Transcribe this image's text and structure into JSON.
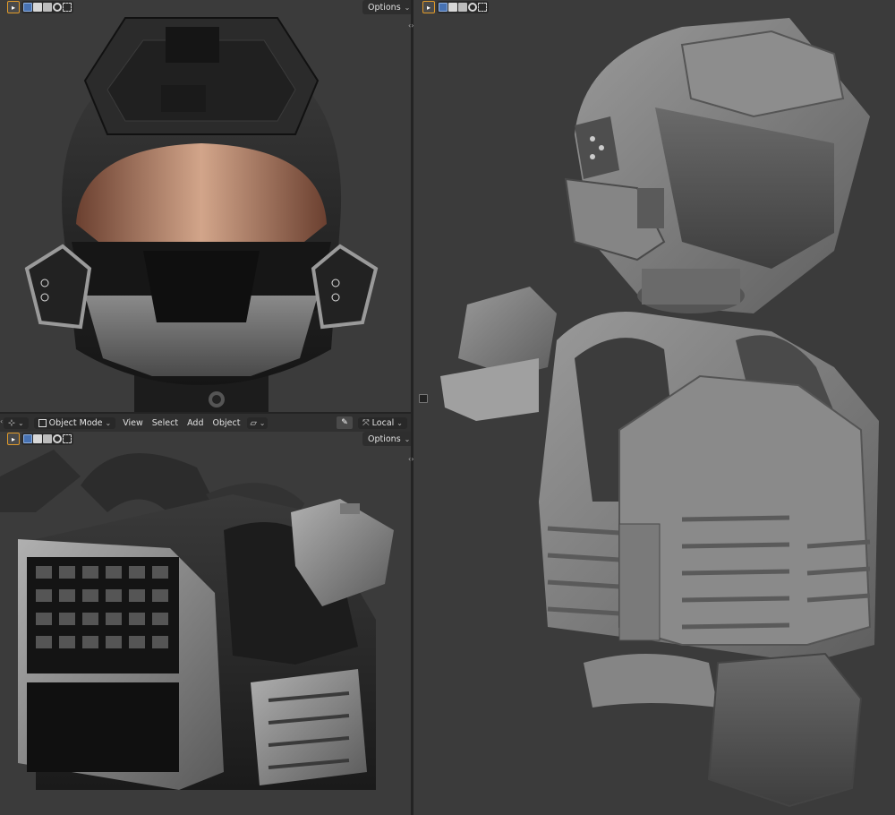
{
  "app": "Blender",
  "top_left": {
    "options_label": "Options"
  },
  "bottom_left": {
    "mode_label": "Object Mode",
    "menu": [
      "View",
      "Select",
      "Add",
      "Object"
    ],
    "transform_orientation": "Local",
    "options_label": "Options"
  },
  "right": {
    "options_label": "Options"
  },
  "icons": [
    "select-box-icon",
    "mode-toggle-icons",
    "chevron-down-icon",
    "eyedropper-icon",
    "transform-icon",
    "object-mode-icon"
  ],
  "colors": {
    "viewport_bg": "#3b3b3b",
    "header_bg": "#303030",
    "active_blue": "#4772b3",
    "select_orange": "#e09a2a"
  }
}
